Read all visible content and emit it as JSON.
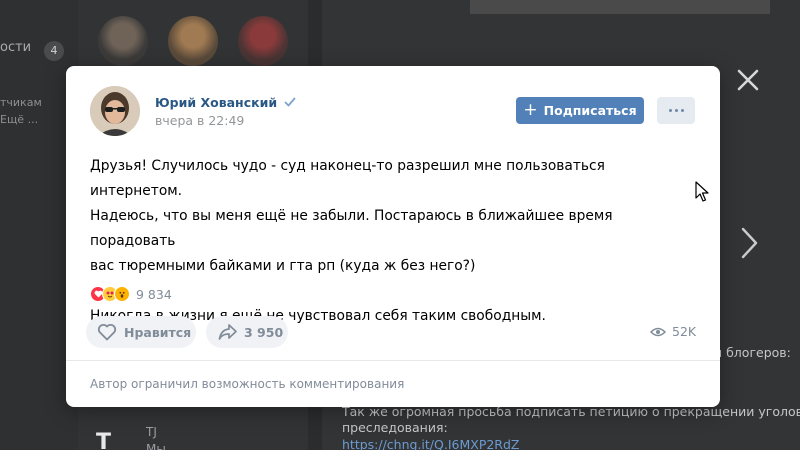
{
  "background": {
    "left_nav_item": "ости",
    "left_nav_badge": "4",
    "left_line_1": "тчикам",
    "left_line_2": "Ещё ...",
    "right_line_1": "и блогеров:",
    "right_line_2": "Так же огромная просьба подписать петицию о прекращении уголовного",
    "right_line_3": "преследования:",
    "right_link": "https://chng.it/Q.I6MXP2RdZ",
    "tj_logo": "T",
    "tj_label": "TJ",
    "tj_sub": "Мы..."
  },
  "post": {
    "author": "Юрий Хованский",
    "time": "вчера в 22:49",
    "subscribe_label": "Подписаться",
    "text": "Друзья! Случилось чудо - суд наконец-то разрешил мне пользоваться интернетом.\nНадеюсь, что вы меня ещё не забыли. Постараюсь в ближайшее время порадовать\nвас тюремными байками и гта рп (куда ж без него?)\n\nНикогда в жизни я ещё не чувствовал себя таким свободным.",
    "reactions_count": "9 834",
    "like_label": "Нравится",
    "share_count": "3 950",
    "views": "52K",
    "comments_notice": "Автор ограничил возможность комментирования"
  },
  "icons": {
    "close": "close-icon",
    "next": "chevron-right-icon",
    "verified": "verified-check-icon",
    "like": "heart-outline-icon",
    "share": "share-arrow-icon",
    "views": "eye-icon",
    "more": "more-dots-icon"
  },
  "colors": {
    "accent": "#5181b8",
    "link": "#2a5885",
    "muted": "#818c99"
  }
}
